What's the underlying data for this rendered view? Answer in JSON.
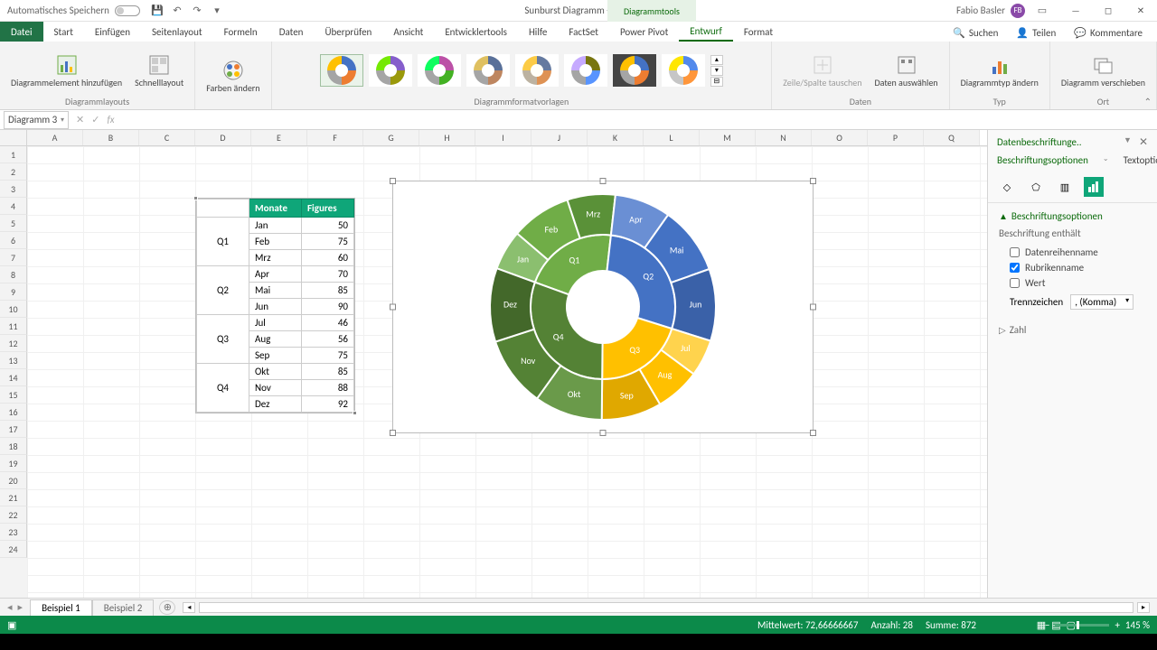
{
  "titlebar": {
    "autosave_label": "Automatisches Speichern",
    "doc_title": "Sunburst Diagramm - Excel",
    "chart_tools": "Diagrammtools",
    "user_name": "Fabio Basler",
    "user_initials": "FB"
  },
  "tabs": {
    "file": "Datei",
    "list": [
      "Start",
      "Einfügen",
      "Seitenlayout",
      "Formeln",
      "Daten",
      "Überprüfen",
      "Ansicht",
      "Entwicklertools",
      "Hilfe",
      "FactSet",
      "Power Pivot",
      "Entwurf",
      "Format"
    ],
    "active": "Entwurf",
    "search": "Suchen",
    "share": "Teilen",
    "comments": "Kommentare"
  },
  "ribbon": {
    "g1_btn1": "Diagrammelement\nhinzufügen",
    "g1_btn2": "Schnelllayout",
    "g1_label": "Diagrammlayouts",
    "g2_btn": "Farben\nändern",
    "g3_label": "Diagrammformatvorlagen",
    "g4_btn1": "Zeile/Spalte\ntauschen",
    "g4_btn2": "Daten\nauswählen",
    "g4_label": "Daten",
    "g5_btn": "Diagrammtyp\nändern",
    "g5_label": "Typ",
    "g6_btn": "Diagramm\nverschieben",
    "g6_label": "Ort"
  },
  "namebox": "Diagramm 3",
  "cols": [
    "A",
    "B",
    "C",
    "D",
    "E",
    "F",
    "G",
    "H",
    "I",
    "J",
    "K",
    "L",
    "M",
    "N",
    "O",
    "P",
    "Q"
  ],
  "rows_count": 24,
  "table": {
    "h1": "Monate",
    "h2": "Figures",
    "quarters": [
      "Q1",
      "Q2",
      "Q3",
      "Q4"
    ],
    "months": [
      "Jan",
      "Feb",
      "Mrz",
      "Apr",
      "Mai",
      "Jun",
      "Jul",
      "Aug",
      "Sep",
      "Okt",
      "Nov",
      "Dez"
    ],
    "values": [
      50,
      75,
      60,
      70,
      85,
      90,
      46,
      56,
      75,
      85,
      88,
      92
    ]
  },
  "chart_data": {
    "type": "sunburst",
    "title": "",
    "inner": [
      {
        "label": "Q1",
        "color": "#70ad47",
        "children": [
          "Jan",
          "Feb",
          "Mrz"
        ],
        "values": [
          50,
          75,
          60
        ]
      },
      {
        "label": "Q2",
        "color": "#4472c4",
        "children": [
          "Apr",
          "Mai",
          "Jun"
        ],
        "values": [
          70,
          85,
          90
        ]
      },
      {
        "label": "Q3",
        "color": "#ffc000",
        "children": [
          "Jul",
          "Aug",
          "Sep"
        ],
        "values": [
          46,
          56,
          75
        ]
      },
      {
        "label": "Q4",
        "color": "#548235",
        "children": [
          "Okt",
          "Nov",
          "Dez"
        ],
        "values": [
          85,
          88,
          92
        ]
      }
    ],
    "total": 872
  },
  "sidepanel": {
    "title": "Datenbeschriftunge..",
    "tab1": "Beschriftungsoptionen",
    "tab2": "Textoptionen",
    "sec1_title": "Beschriftungsoptionen",
    "sec1_sub": "Beschriftung enthält",
    "chk_series": "Datenreihenname",
    "chk_category": "Rubrikenname",
    "chk_value": "Wert",
    "sep_label": "Trennzeichen",
    "sep_value": ", (Komma)",
    "sec2_title": "Zahl"
  },
  "sheets": {
    "active": "Beispiel 1",
    "other": "Beispiel 2"
  },
  "statusbar": {
    "avg_label": "Mittelwert:",
    "avg": "72,66666667",
    "count_label": "Anzahl:",
    "count": "28",
    "sum_label": "Summe:",
    "sum": "872",
    "zoom": "145 %"
  }
}
